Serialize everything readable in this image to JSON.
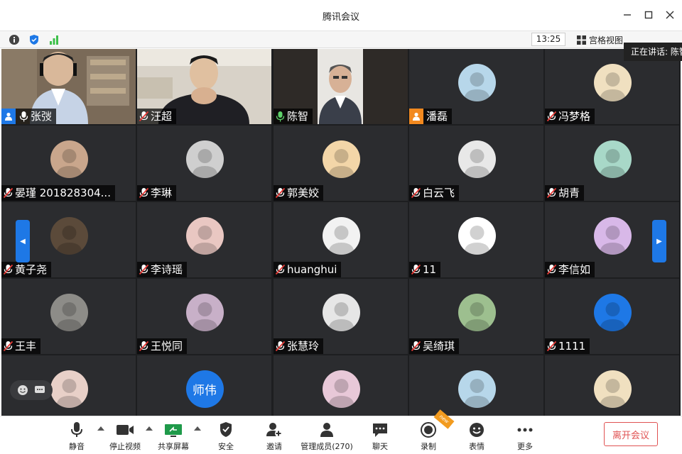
{
  "window": {
    "title": "腾讯会议"
  },
  "infobar": {
    "time": "13:25",
    "view_label": "宫格视图",
    "speaking_text": "正在讲话: 陈智"
  },
  "participants": [
    {
      "name": "张弢",
      "role": "host",
      "video": true,
      "mic": "on"
    },
    {
      "name": "汪超",
      "video": true,
      "mic": "off"
    },
    {
      "name": "陈智",
      "video": true,
      "mic": "on",
      "active": true
    },
    {
      "name": "潘磊",
      "role": "cohost",
      "mic": "off"
    },
    {
      "name": "冯梦格",
      "mic": "off"
    },
    {
      "name": "晏瑾 201828304...",
      "mic": "off"
    },
    {
      "name": "李琳",
      "mic": "off"
    },
    {
      "name": "郭美姣",
      "mic": "off"
    },
    {
      "name": "白云飞",
      "mic": "off"
    },
    {
      "name": "胡青",
      "mic": "off"
    },
    {
      "name": "黄子尧",
      "mic": "off"
    },
    {
      "name": "李诗瑶",
      "mic": "off"
    },
    {
      "name": "huanghui",
      "mic": "off"
    },
    {
      "name": "11",
      "mic": "off"
    },
    {
      "name": "李信如",
      "mic": "off"
    },
    {
      "name": "王丰",
      "mic": "off"
    },
    {
      "name": "王悦同",
      "mic": "off"
    },
    {
      "name": "张慧玲",
      "mic": "off"
    },
    {
      "name": "吴绮琪",
      "mic": "off"
    },
    {
      "name": "1111",
      "mic": "off"
    },
    {
      "name": "",
      "mic": "off"
    },
    {
      "name": "",
      "mic": "off",
      "avatar_text": "师伟"
    },
    {
      "name": "",
      "mic": "off"
    },
    {
      "name": "",
      "mic": "off"
    },
    {
      "name": "",
      "mic": "off"
    }
  ],
  "toolbar": {
    "mute": "静音",
    "stop_video": "停止视频",
    "share_screen": "共享屏幕",
    "security": "安全",
    "invite": "邀请",
    "manage_members": "管理成员(270)",
    "chat": "聊天",
    "record": "录制",
    "record_badge": "new",
    "emoji": "表情",
    "more": "更多",
    "leave": "离开会议"
  },
  "colors": {
    "accent": "#1e78e6",
    "leave": "#e05252",
    "active_border": "#3ec04a",
    "tile_bg": "#2b2c2f"
  }
}
